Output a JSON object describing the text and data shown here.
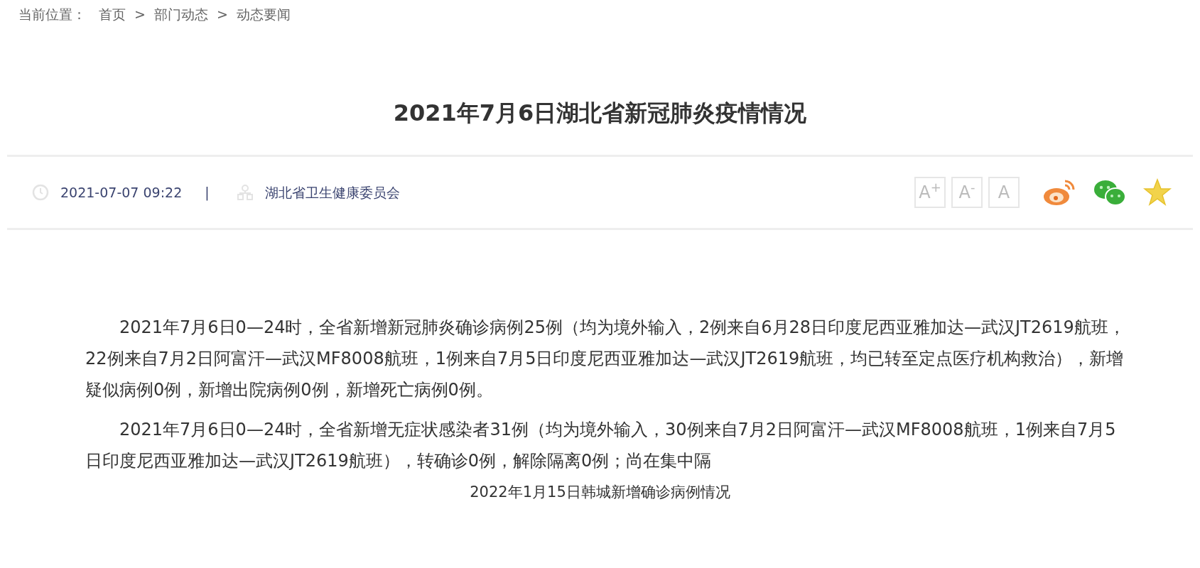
{
  "breadcrumb": [
    {
      "kind": "label",
      "text": "当前位置："
    },
    {
      "kind": "link",
      "text": "首页"
    },
    {
      "kind": "separator",
      "text": ">"
    },
    {
      "kind": "link",
      "text": "部门动态"
    },
    {
      "kind": "separator",
      "text": ">"
    },
    {
      "kind": "link",
      "text": "动态要闻"
    }
  ],
  "title": "2021年7月6日湖北省新冠肺炎疫情情况",
  "meta": {
    "date": "2021-07-07 09:22",
    "divider": "|",
    "source": "湖北省卫生健康委员会"
  },
  "font_buttons": [
    "A$^{+}$",
    "A$^{-}$",
    "A"
  ],
  "paragraphs": [
    "2021年7月6日0—24时，全省新增新冠肺炎确诊病例25例（均为境外输入，2例来自6月28日印度尼西亚雅加达—武汉JT2619航班，22例来自7月2日阿富汗—武汉MF8008航班，1例来自7月5日印度尼西亚雅加达—武汉JT2619航班，均已转至定点医疗机构救治），新增疑似病例0例，新增出院病例0例，新增死亡病例0例。",
    "2021年7月6日0—24时，全省新增无症状感染者31例（均为境外输入，30例来自7月2日阿富汗—武汉MF8008航班，1例来自7月5日印度尼西亚雅加达—武汉JT2619航班），转确诊0例，解除隔离0例；尚在集中隔"
  ],
  "caption": "2022年1月15日韩城新增确诊病例情况"
}
